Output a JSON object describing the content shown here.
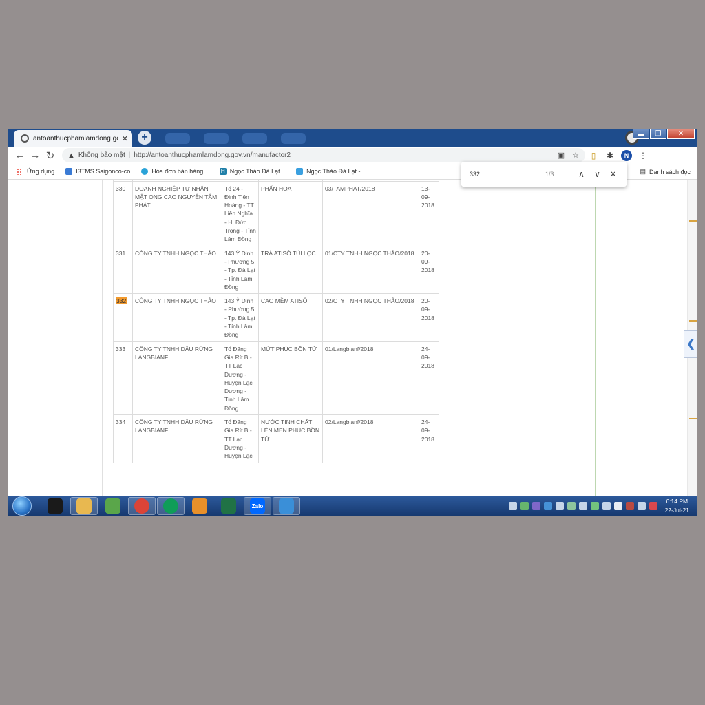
{
  "browser": {
    "tab_title": "antoanthucphamlamdong.gov.vn",
    "tab_close": "✕",
    "new_tab": "+",
    "window_controls": [
      "▬",
      "❐",
      "✕"
    ]
  },
  "toolbar": {
    "back": "←",
    "forward": "→",
    "reload": "↻",
    "security_icon": "▲",
    "security_text": "Không bảo mật",
    "separator": "|",
    "url": "http://antoanthucphamlamdong.gov.vn/manufactor2",
    "page_info_icon": "▣",
    "star_icon": "☆",
    "extension_icon": "▯",
    "puzzle_icon": "✱",
    "avatar_letter": "N",
    "menu_icon": "⋮"
  },
  "bookmarks": {
    "items": [
      {
        "label": "Ứng dụng",
        "icon": "apps-grid-icon",
        "color": "#e94235"
      },
      {
        "label": "I3TMS Saigonco-co",
        "icon": "page-icon",
        "color": "#3a7bd5"
      },
      {
        "label": "Hóa đơn bán hàng...",
        "icon": "invoice-icon",
        "color": "#2aa3d8"
      },
      {
        "label": "Ngọc Thảo Đà Lạt...",
        "icon": "h-site-icon",
        "color": "#1f7fa8"
      },
      {
        "label": "Ngọc Thảo Đà Lạt -...",
        "icon": "site-icon",
        "color": "#3aa0e0"
      }
    ],
    "reading_list_label": "Danh sách đọc",
    "reading_list_icon": "▤"
  },
  "find_bar": {
    "query": "332",
    "count": "1/3",
    "prev": "∧",
    "next": "∨",
    "close": "✕"
  },
  "table": {
    "rows": [
      {
        "no": "",
        "name": "",
        "address": "Trọng - Tỉnh Lâm Đồng",
        "product": "",
        "cert": "",
        "date": ""
      },
      {
        "no": "330",
        "name": "DOANH NGHIỆP TƯ NHÂN MẬT ONG CAO NGUYÊN TÂM PHÁT",
        "address": "Tổ 24 - Đinh Tiên Hoàng - TT Liên Nghĩa - H. Đức Trọng - Tỉnh Lâm Đồng",
        "product": "PHẤN HOA",
        "cert": "03/TAMPHAT/2018",
        "date": "13-09-2018"
      },
      {
        "no": "331",
        "name": "CÔNG TY TNHH NGỌC THẢO",
        "address": "143 Ỷ Dinh - Phường 5 - Tp. Đà Lạt - Tỉnh Lâm Đồng",
        "product": "TRÀ ATISÔ TÚI LỌC",
        "cert": "01/CTY TNHH NGỌC THẢO/2018",
        "date": "20-09-2018"
      },
      {
        "no": "332",
        "name": "CÔNG TY TNHH NGỌC THẢO",
        "address": "143 Ỷ Dinh - Phường 5 - Tp. Đà Lạt - Tỉnh Lâm Đồng",
        "product": "CAO MỀM ATISÔ",
        "cert": "02/CTY TNHH NGỌC THẢO/2018",
        "date": "20-09-2018"
      },
      {
        "no": "333",
        "name": "CÔNG TY TNHH DÂU RỪNG LANGBIANF",
        "address": "Tổ Đăng Gia Rít B - TT Lạc Dương - Huyện Lạc Dương - Tỉnh Lâm Đồng",
        "product": "MỨT PHÚC BỒN TỬ",
        "cert": "01/Langbianf/2018",
        "date": "24-09-2018"
      },
      {
        "no": "334",
        "name": "CÔNG TY TNHH DÂU RỪNG LANGBIANF",
        "address": "Tổ Đăng Gia Rít B - TT Lạc Dương - Huyện Lạc",
        "product": "NƯỚC TINH CHẤT LÊN MEN PHÚC BỒN TỬ",
        "cert": "02/Langbianf/2018",
        "date": "24-09-2018"
      }
    ]
  },
  "side_panel_toggle": "❮",
  "taskbar": {
    "apps": [
      {
        "name": "garena",
        "color": "#1a1a1a",
        "open": false
      },
      {
        "name": "file-explorer",
        "color": "#e8b850",
        "open": true
      },
      {
        "name": "green-app",
        "color": "#5aa64a",
        "open": false
      },
      {
        "name": "chrome-profile",
        "color": "#db4437",
        "open": true
      },
      {
        "name": "chrome",
        "color": "#0f9d58",
        "open": true
      },
      {
        "name": "media-player",
        "color": "#e8902a",
        "open": false
      },
      {
        "name": "excel",
        "color": "#207245",
        "open": false
      },
      {
        "name": "zalo",
        "color": "#0068ff",
        "label": "Zalo",
        "open": true
      },
      {
        "name": "remote-desktop",
        "color": "#3a8fd8",
        "open": true
      }
    ],
    "time": "6:14 PM",
    "date": "22-Jul-21"
  }
}
